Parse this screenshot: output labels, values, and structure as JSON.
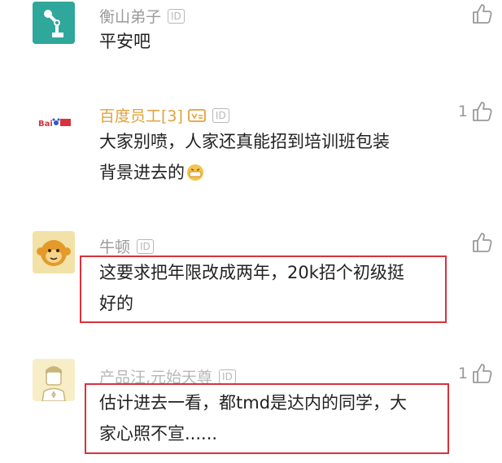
{
  "comments": [
    {
      "username": "衡山弟子",
      "id_badge": "ID",
      "text_lines": [
        "平安吧"
      ],
      "like_count": "",
      "avatar": "robot-arm-icon",
      "highlighted": false
    },
    {
      "username": "百度员工[3]",
      "id_badge": "ID",
      "text_lines": [
        "大家别喷，人家还真能招到培训班包装",
        "背景进去的"
      ],
      "like_count": "1",
      "avatar": "baidu-logo",
      "avatar_text": "Bai百度",
      "verified_badge": true,
      "highlighted": false
    },
    {
      "username": "牛顿",
      "id_badge": "ID",
      "text_lines": [
        "这要求把年限改成两年，20k招个初级挺",
        "好的"
      ],
      "like_count": "",
      "avatar": "monkey-icon",
      "highlighted": true
    },
    {
      "username": "产品汪,元始天尊",
      "id_badge": "ID",
      "text_lines": [
        "估计进去一看，都tmd是达内的同学，大",
        "家心照不宣......"
      ],
      "like_count": "1",
      "avatar": "person-icon",
      "highlighted": true
    }
  ],
  "colors": {
    "highlight_border": "#d8323c",
    "baidu_name": "#e0a23a",
    "text": "#222222",
    "muted": "#9a9a9a"
  }
}
